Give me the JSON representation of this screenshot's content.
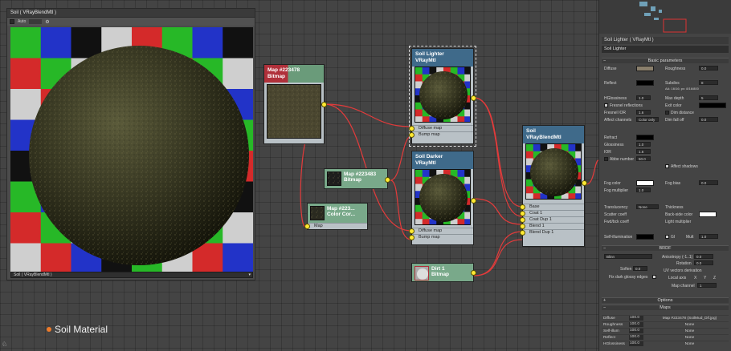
{
  "preview": {
    "title": "Soil  ( VRayBlendMtl )",
    "toolbar_auto": "Auto",
    "toolbar_update": "Update",
    "select_value": "Soil  ( VRayBlendMtl )"
  },
  "nodes": {
    "bitmap1": {
      "title": "Map #223478",
      "type": "Bitmap"
    },
    "bitmap2": {
      "title": "Map #223483",
      "type": "Bitmap"
    },
    "colorcorr": {
      "title": "Map #223...",
      "type": "Color Cor..."
    },
    "colorcorr_slot": "Map",
    "lighter": {
      "title": "Soil Lighter",
      "type": "VRayMtl",
      "slots": [
        "Diffuse map",
        "Bump map"
      ]
    },
    "darker": {
      "title": "Soil Darker",
      "type": "VRayMtl",
      "slots": [
        "Diffuse map",
        "Bump map"
      ]
    },
    "blend": {
      "title": "Soil",
      "type": "VRayBlendMtl",
      "slots": [
        "Base",
        "Coat 1",
        "Coat Dup 1",
        "Blend 1",
        "Blend Dup 1"
      ]
    },
    "dirt": {
      "title": "Dirt 1",
      "type": "Bitmap"
    }
  },
  "caption": "Soil Material",
  "panel": {
    "title": "Soil Lighter  ( VRayMtl )",
    "name": "Soil Lighter",
    "basic_params": "Basic parameters",
    "diffuse": "Diffuse",
    "roughness": "Roughness",
    "roughness_val": "0.0",
    "reflect": "Reflect",
    "hilight": "HGlossiness",
    "hilight_val": "1.0",
    "fresnel": "Fresnel reflections",
    "fresnel_ior": "Fresnel IOR",
    "fresnel_ior_val": "1.6",
    "affect_channels": "Affect channels",
    "affect_channels_val": "Color only",
    "subdivs": "Subdivs",
    "subdivs_val": "8",
    "aa": "AA: 16/16; px: 8/16/800",
    "max_depth": "Max depth",
    "max_depth_val": "5",
    "exit_color": "Exit color",
    "dim_distance": "Dim distance",
    "dim_falloff": "Dim fall off",
    "dim_falloff_val": "0.0",
    "refract": "Refract",
    "glossiness": "Glossiness",
    "glossiness_val": "1.0",
    "ior": "IOR",
    "ior_val": "1.6",
    "abbe": "Abbe number",
    "abbe_val": "50.0",
    "affect_shadows": "Affect shadows",
    "fog_color": "Fog color",
    "fog_bias": "Fog bias",
    "fog_bias_val": "0.0",
    "fog_mult": "Fog multiplier",
    "fog_mult_val": "1.0",
    "translucency": "Translucency",
    "translucency_val": "None",
    "thickness": "Thickness",
    "scatter": "Scatter coeff",
    "backside": "Back-side color",
    "fwdbck": "Fwd/bck coeff",
    "light_mult": "Light multiplier",
    "self_illum": "Self-illumination",
    "gi": "GI",
    "mult": "Mult",
    "mult_val": "1.0",
    "brdf": "BRDF",
    "brdf_type": "Blinn",
    "anisotropy": "Anisotropy (-1..1)",
    "anisotropy_val": "0.0",
    "rotation": "Rotation",
    "rotation_val": "0.0",
    "soften": "Soften",
    "soften_val": "0.0",
    "uv_vectors": "UV vectors derivation",
    "local_axis": "Local axis",
    "axis_x": "X",
    "axis_y": "Y",
    "axis_z": "Z",
    "map_channel": "Map channel",
    "map_channel_val": "1",
    "fix_dark": "Fix dark glossy edges",
    "options": "Options",
    "maps": "Maps",
    "map_rows": [
      {
        "name": "Diffuse",
        "val": "100.0",
        "map": "Map #223478 (SoilMud_Dif.jpg)"
      },
      {
        "name": "Roughness",
        "val": "100.0",
        "map": "None"
      },
      {
        "name": "Self-illum",
        "val": "100.0",
        "map": "None"
      },
      {
        "name": "Reflect",
        "val": "100.0",
        "map": "None"
      },
      {
        "name": "HGlossiness",
        "val": "100.0",
        "map": "None"
      }
    ]
  },
  "colors": {
    "accent_orange": "#ee7b2a",
    "socket_yellow": "#ffe933",
    "wire_red": "#e23b3b",
    "node_blue": "#3f6a8a",
    "node_green": "#6a9b7a"
  }
}
